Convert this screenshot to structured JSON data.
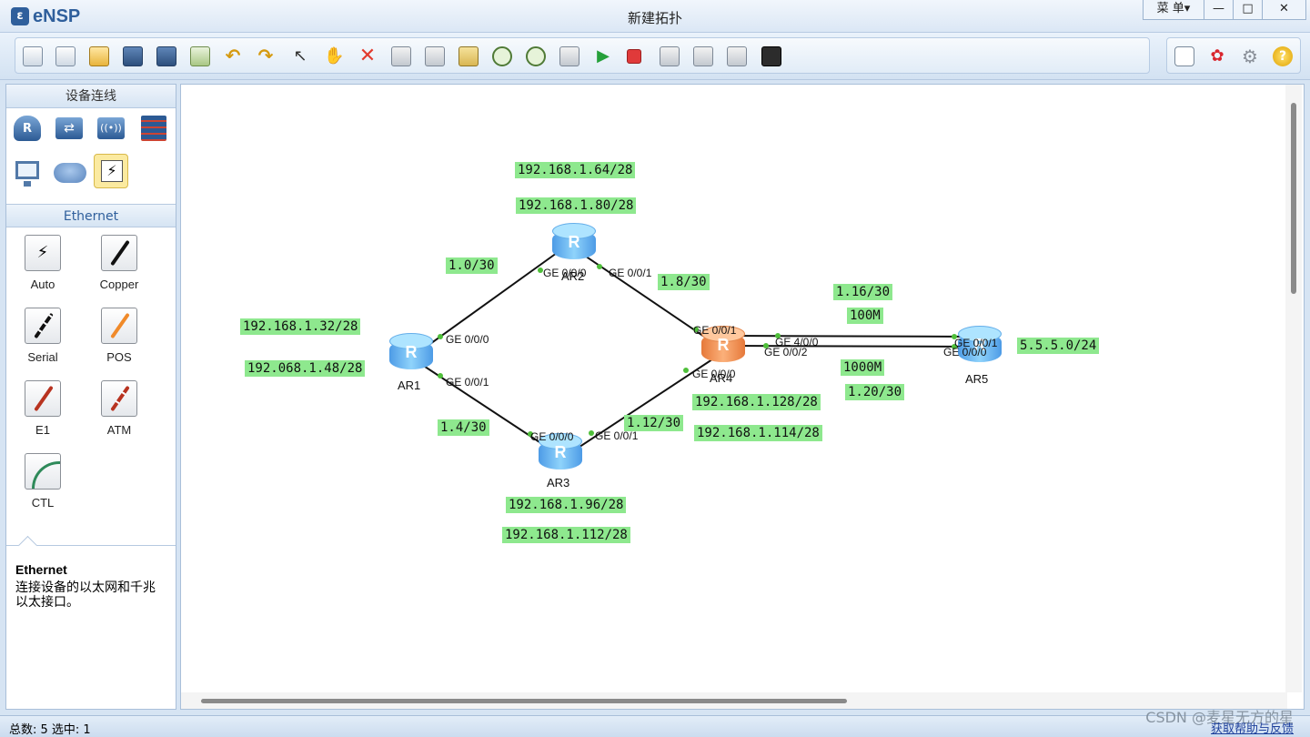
{
  "app": {
    "logo_text": "eNSP",
    "title": "新建拓扑"
  },
  "window": {
    "menu_label": "菜 单▾",
    "minimize": "—",
    "maximize": "□",
    "close": "✕"
  },
  "left_panel": {
    "device_header": "设备连线",
    "cable_header": "Ethernet",
    "cables": [
      {
        "label": "Auto",
        "color": "#111111"
      },
      {
        "label": "Copper",
        "color": "#111111"
      },
      {
        "label": "Serial",
        "color": "#111111"
      },
      {
        "label": "POS",
        "color": "#f08a2a"
      },
      {
        "label": "E1",
        "color": "#b83320"
      },
      {
        "label": "ATM",
        "color": "#b83320"
      },
      {
        "label": "CTL",
        "color": "#2f8a5a"
      }
    ],
    "description": {
      "title": "Ethernet",
      "text": "连接设备的以太网和千兆以太接口。"
    }
  },
  "topology": {
    "routers": {
      "ar1": "AR1",
      "ar2": "AR2",
      "ar3": "AR3",
      "ar4": "AR4",
      "ar5": "AR5"
    },
    "ports": {
      "ar1_g000": "GE 0/0/0",
      "ar1_g001": "GE 0/0/1",
      "ar2_g000": "GE 0/0/0",
      "ar2_g001": "GE 0/0/1",
      "ar3_g000": "GE 0/0/0",
      "ar3_g001": "GE 0/0/1",
      "ar4_g001": "GE 0/0/1",
      "ar4_g000": "GE 0/0/0",
      "ar4_g400": "GE 4/0/0",
      "ar4_g002": "GE 0/0/2",
      "ar5_g001": "GE 0/0/1",
      "ar5_g000": "GE 0/0/0"
    },
    "labels": {
      "ar2_net1": "192.168.1.64/28",
      "ar2_net2": "192.168.1.80/28",
      "link_ar1_ar2": "1.0/30",
      "link_ar2_ar4": "1.8/30",
      "ar1_net1": "192.168.1.32/28",
      "ar1_net2": "192.068.1.48/28",
      "link_ar1_ar3": "1.4/30",
      "link_ar3_ar4": "1.12/30",
      "link_ar4_ar5_a": "1.16/30",
      "speed_a": "100M",
      "speed_b": "1000M",
      "link_ar4_ar5_b": "1.20/30",
      "ar5_net": "5.5.5.0/24",
      "ar4_net1": "192.168.1.128/28",
      "ar4_net2": "192.168.1.114/28",
      "ar3_net1": "192.168.1.96/28",
      "ar3_net2": "192.168.1.112/28"
    },
    "label_color": "#8ee88e"
  },
  "status": {
    "left": "总数: 5 选中: 1",
    "right": "获取帮助与反馈",
    "watermark": "CSDN @麦星无方的星"
  }
}
